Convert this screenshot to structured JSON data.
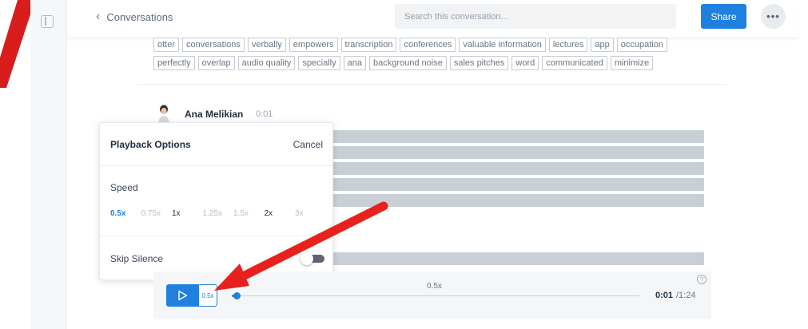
{
  "header": {
    "back_label": "Conversations",
    "search_placeholder": "Search this conversation...",
    "share_label": "Share",
    "more_label": "•••"
  },
  "keywords": {
    "row1": [
      "otter",
      "conversations",
      "verbally",
      "empowers",
      "transcription",
      "conferences",
      "valuable information",
      "lectures",
      "app",
      "occupation"
    ],
    "row2": [
      "perfectly",
      "overlap",
      "audio quality",
      "specially",
      "ana",
      "background noise",
      "sales pitches",
      "word",
      "communicated",
      "minimize"
    ]
  },
  "speaker": {
    "name": "Ana Melikian",
    "time": "0:01"
  },
  "playback_options": {
    "title": "Playback Options",
    "cancel_label": "Cancel",
    "speed_label": "Speed",
    "speeds": [
      "0.5x",
      "0.75x",
      "1x",
      "1.25x",
      "1.5x",
      "2x",
      "3x"
    ],
    "selected_speed": "0.5x",
    "skip_silence_label": "Skip Silence",
    "skip_silence_on": false
  },
  "player": {
    "speed_button": "0.5x",
    "speed_display": "0.5x",
    "current_time": "0:01",
    "total_time": "/1:24",
    "progress": 0.012,
    "help_label": "?"
  },
  "colors": {
    "accent": "#1f80e0",
    "annotation": "#e8211c"
  },
  "icons": {
    "sidebar_toggle": "sidebar-panel-icon",
    "back": "chevron-left-icon",
    "play": "play-icon",
    "help": "question-circle-icon"
  }
}
